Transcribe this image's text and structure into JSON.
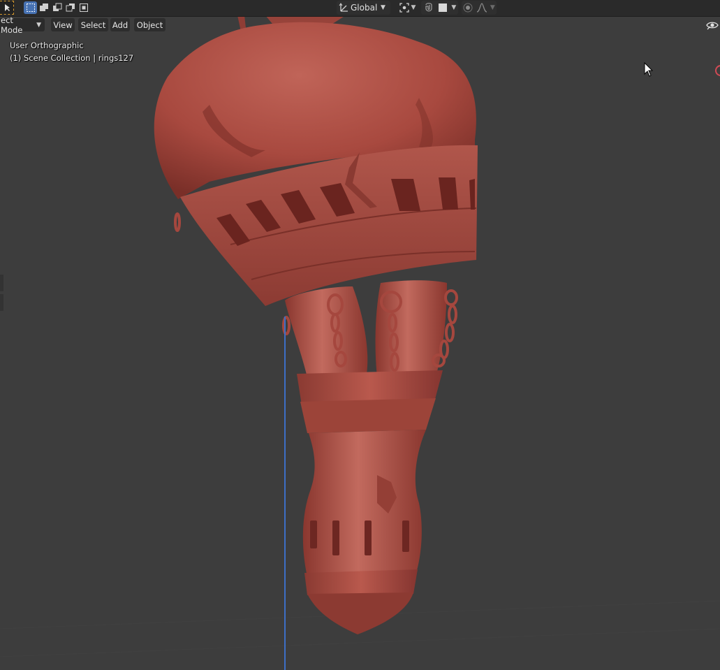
{
  "toolbar": {
    "orientation_label": "Global"
  },
  "header": {
    "mode_label": "ect Mode",
    "menus": [
      "View",
      "Select",
      "Add",
      "Object"
    ]
  },
  "viewport": {
    "view_name": "User Orthographic",
    "collection_info": "(1) Scene Collection | rings127"
  },
  "colors": {
    "accent": "#4772b3",
    "model": "#a5473e",
    "axis": "#3d6fc7",
    "background": "#3d3d3d"
  },
  "icons": [
    "select-cursor-icon",
    "box-select-icon",
    "mode-extend-icon",
    "mode-subtract-icon",
    "mode-difference-icon",
    "mode-intersect-icon",
    "transform-orientation-icon",
    "pivot-point-icon",
    "snap-icon",
    "snap-increment-icon",
    "proportional-edit-icon",
    "falloff-icon",
    "visibility-icon"
  ]
}
